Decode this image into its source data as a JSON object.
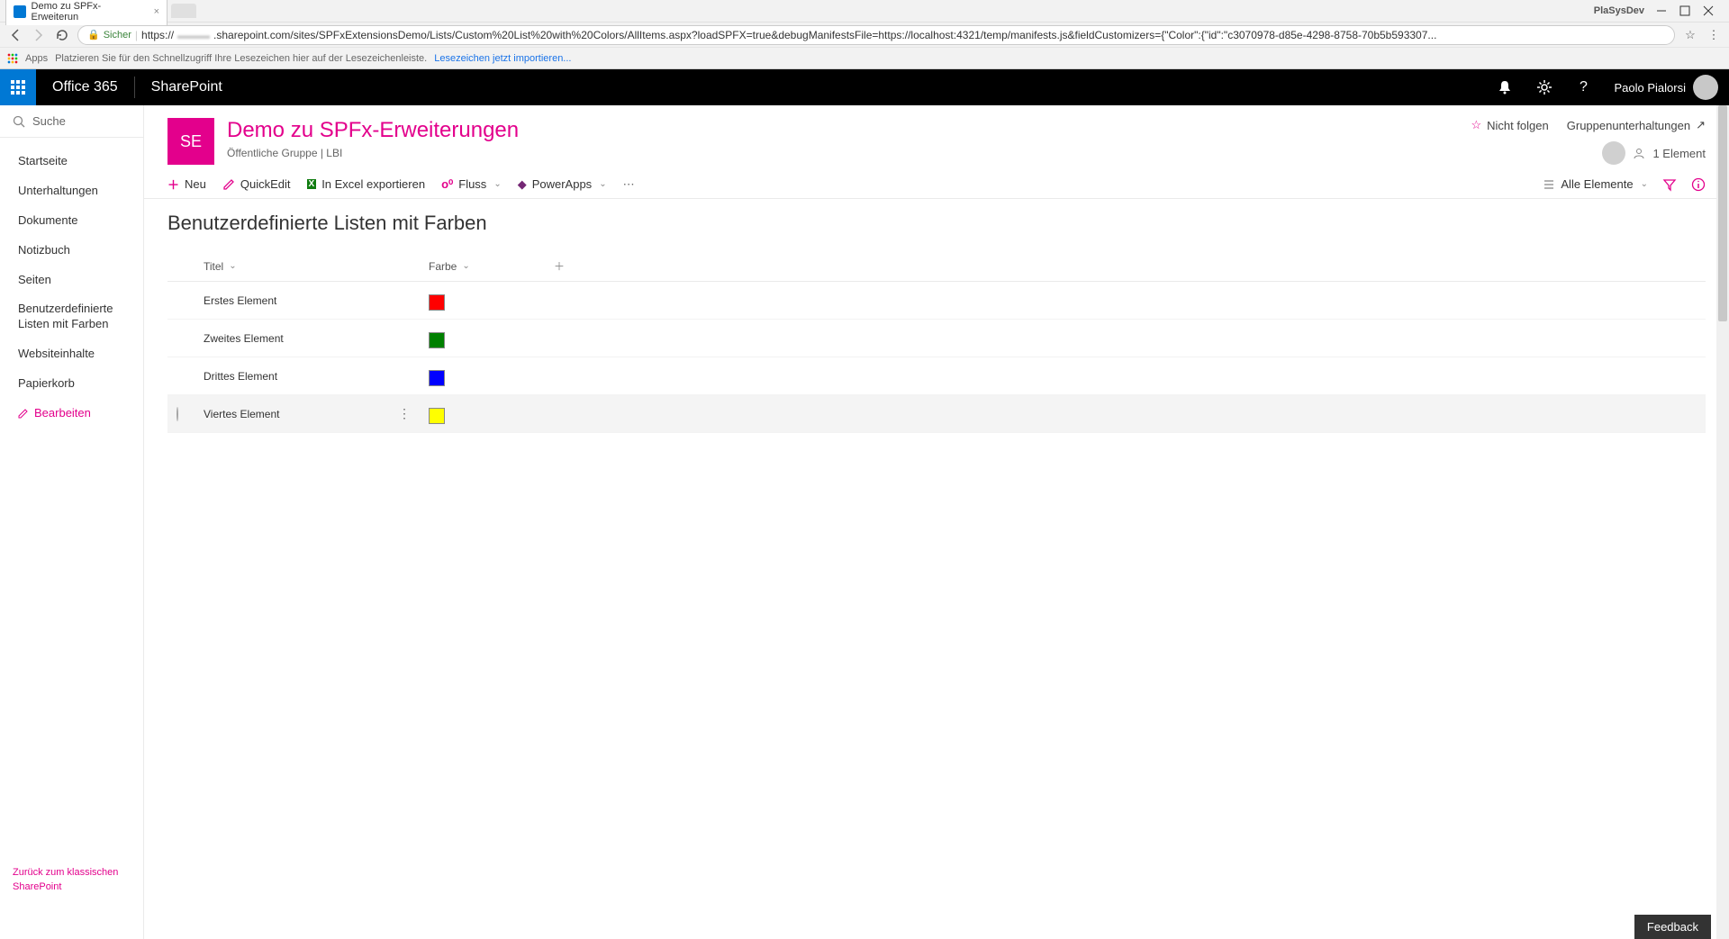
{
  "browser": {
    "tab_title": "Demo zu SPFx-Erweiterun",
    "ext_label": "PlaSysDev",
    "security_label": "Sicher",
    "url_prefix": "https://",
    "url_blur": "▬▬▬",
    "url_rest": ".sharepoint.com/sites/SPFxExtensionsDemo/Lists/Custom%20List%20with%20Colors/AllItems.aspx?loadSPFX=true&debugManifestsFile=https://localhost:4321/temp/manifests.js&fieldCustomizers={\"Color\":{\"id\":\"c3070978-d85e-4298-8758-70b5b593307...",
    "apps_label": "Apps",
    "bookmark_hint": "Platzieren Sie für den Schnellzugriff Ihre Lesezeichen hier auf der Lesezeichenleiste.",
    "bookmark_link": "Lesezeichen jetzt importieren..."
  },
  "suite": {
    "o365": "Office 365",
    "app": "SharePoint",
    "user": "Paolo Pialorsi"
  },
  "leftnav": {
    "search": "Suche",
    "items": [
      "Startseite",
      "Unterhaltungen",
      "Dokumente",
      "Notizbuch",
      "Seiten",
      "Benutzerdefinierte Listen mit Farben",
      "Websiteinhalte",
      "Papierkorb"
    ],
    "edit": "Bearbeiten",
    "classic": "Zurück zum klassischen SharePoint"
  },
  "site": {
    "tile": "SE",
    "title": "Demo zu SPFx-Erweiterungen",
    "sub": "Öffentliche Gruppe  |  LBI",
    "not_follow": "Nicht folgen",
    "group_conv": "Gruppenunterhaltungen",
    "members": "1 Element"
  },
  "cmdbar": {
    "new": "Neu",
    "quickedit": "QuickEdit",
    "excel": "In Excel exportieren",
    "flow": "Fluss",
    "powerapps": "PowerApps",
    "view": "Alle Elemente"
  },
  "list": {
    "title": "Benutzerdefinierte Listen mit Farben",
    "columns": {
      "title": "Titel",
      "color": "Farbe"
    },
    "rows": [
      {
        "title": "Erstes Element",
        "color": "#ff0000",
        "hovered": false
      },
      {
        "title": "Zweites Element",
        "color": "#008000",
        "hovered": false
      },
      {
        "title": "Drittes Element",
        "color": "#0000ff",
        "hovered": false
      },
      {
        "title": "Viertes Element",
        "color": "#ffff00",
        "hovered": true
      }
    ]
  },
  "feedback": "Feedback"
}
